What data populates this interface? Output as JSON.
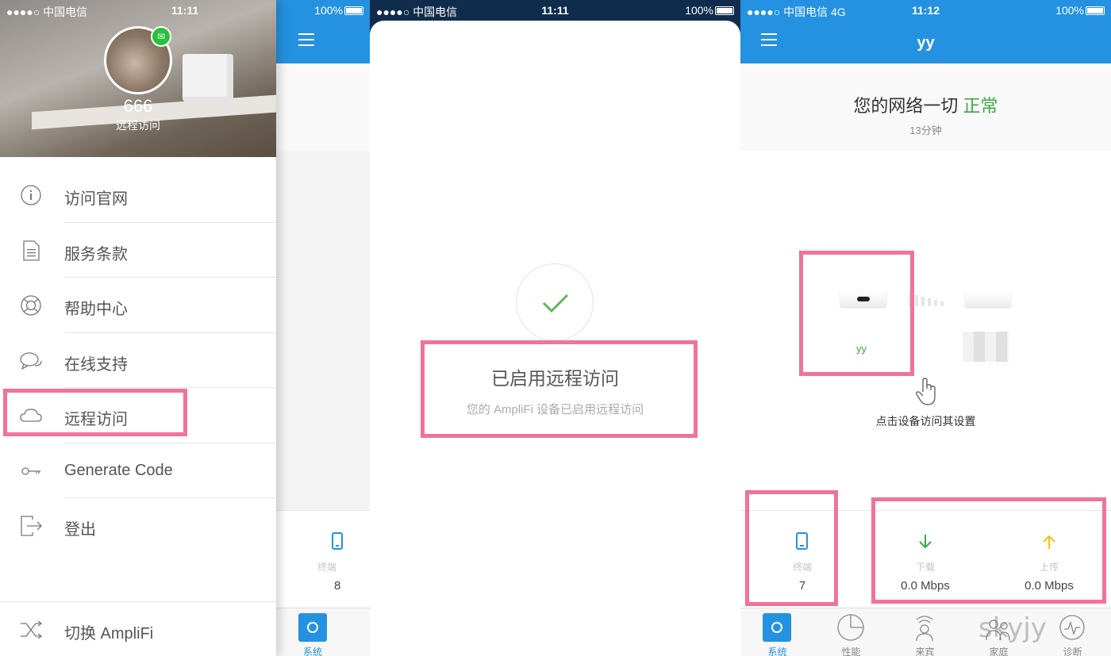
{
  "screen1": {
    "statusbar": {
      "carrier": "●●●●○ 中国电信 ",
      "time": "11:11",
      "battery": "100%"
    },
    "profile": {
      "name": "666",
      "subtitle": "远程访问"
    },
    "menu": [
      {
        "label": "访问官网",
        "icon": "info-icon"
      },
      {
        "label": "服务条款",
        "icon": "document-icon"
      },
      {
        "label": "帮助中心",
        "icon": "lifebuoy-icon"
      },
      {
        "label": "在线支持",
        "icon": "chat-bubbles-icon"
      },
      {
        "label": "远程访问",
        "icon": "cloud-icon"
      },
      {
        "label": "Generate Code",
        "icon": "key-icon"
      },
      {
        "label": "登出",
        "icon": "logout-icon"
      }
    ],
    "switch_label": "切换 AmpliFi",
    "background_app": {
      "stat_label": "终端",
      "stat_value": "8",
      "tab_label": "系统"
    }
  },
  "screen2": {
    "statusbar": {
      "carrier": "●●●●○ 中国电信 ",
      "time": "11:11",
      "battery": "100%"
    },
    "title": "已启用远程访问",
    "subtitle": "您的 AmpliFi 设备已启用远程访问"
  },
  "screen3": {
    "statusbar": {
      "carrier": "●●●●○ 中国电信  4G",
      "time": "11:12",
      "battery": "100%"
    },
    "header_title": "yy",
    "status": {
      "prefix": "您的网络一切 ",
      "state": "正常",
      "uptime": "13分钟"
    },
    "device_name": "yy",
    "tap_hint": "点击设备访问其设置",
    "stats": [
      {
        "label": "终端",
        "value": "7",
        "icon": "phone-icon"
      },
      {
        "label": "下载",
        "value": "0.0 Mbps",
        "icon": "arrow-down-icon"
      },
      {
        "label": "上传",
        "value": "0.0 Mbps",
        "icon": "arrow-up-icon"
      }
    ],
    "tabs": [
      {
        "label": "系统",
        "icon": "system-icon"
      },
      {
        "label": "性能",
        "icon": "pie-icon"
      },
      {
        "label": "来宾",
        "icon": "guest-icon"
      },
      {
        "label": "家庭",
        "icon": "family-icon"
      },
      {
        "label": "诊断",
        "icon": "diagnostics-icon"
      }
    ],
    "watermark": "skyjy"
  },
  "colors": {
    "accent": "#2492e0",
    "ok_green": "#3aa845",
    "highlight": "#f0739a",
    "upload_yellow": "#f4c21b"
  }
}
